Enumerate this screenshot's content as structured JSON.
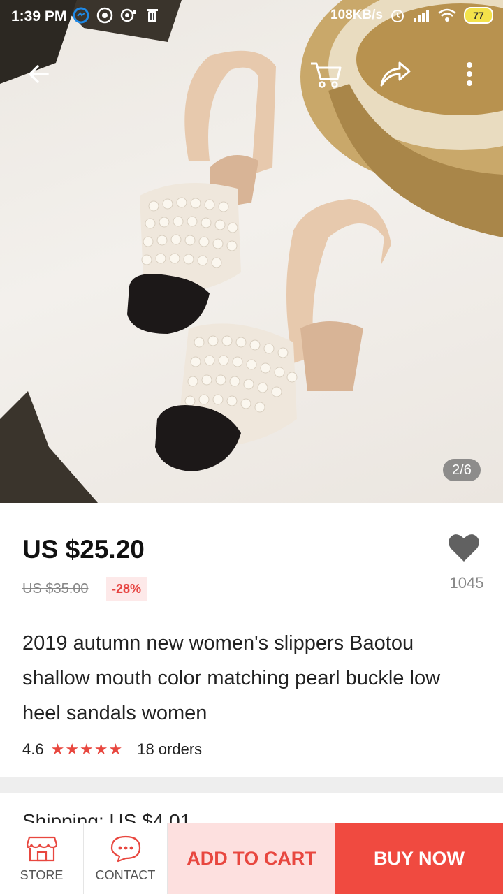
{
  "status_bar": {
    "time": "1:39 PM",
    "net_speed": "108KB/s",
    "battery": "77"
  },
  "gallery": {
    "counter": "2/6"
  },
  "product": {
    "price": "US $25.20",
    "original_price": "US $35.00",
    "discount": "-28%",
    "wishlist_count": "1045",
    "title": "2019 autumn new women's slippers Baotou shallow mouth color matching pearl buckle low heel sandals women",
    "rating": "4.6",
    "stars": "★★★★★",
    "orders": "18 orders",
    "shipping": "Shipping: US $4.01"
  },
  "bottom_bar": {
    "store_label": "STORE",
    "contact_label": "CONTACT",
    "add_to_cart_label": "ADD TO CART",
    "buy_now_label": "BUY NOW"
  },
  "colors": {
    "accent_red": "#f04a40",
    "cart_bg": "#fde0df",
    "star_red": "#e8473f"
  }
}
